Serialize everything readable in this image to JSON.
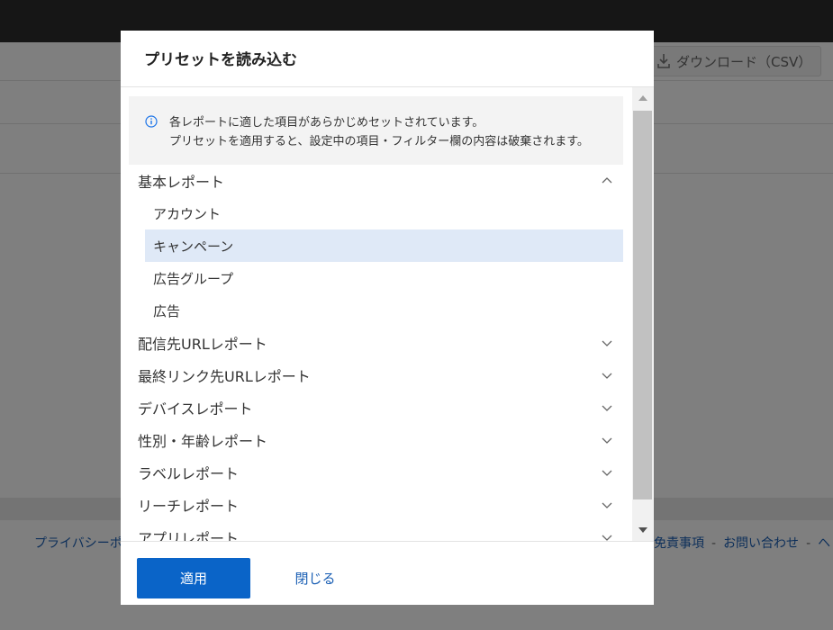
{
  "background": {
    "download_button": "ダウンロード（CSV）",
    "footer_left": "プライバシーポ",
    "footer_right": [
      "免責事項",
      "お問い合わせ",
      "ヘ"
    ],
    "footer_sep": "-"
  },
  "modal": {
    "title": "プリセットを読み込む",
    "info": {
      "line1": "各レポートに適した項目があらかじめセットされています。",
      "line2": "プリセットを適用すると、設定中の項目・フィルター欄の内容は破棄されます。"
    },
    "categories": [
      {
        "label": "基本レポート",
        "expanded": true,
        "items": [
          {
            "label": "アカウント",
            "selected": false
          },
          {
            "label": "キャンペーン",
            "selected": true
          },
          {
            "label": "広告グループ",
            "selected": false
          },
          {
            "label": "広告",
            "selected": false
          }
        ]
      },
      {
        "label": "配信先URLレポート",
        "expanded": false
      },
      {
        "label": "最終リンク先URLレポート",
        "expanded": false
      },
      {
        "label": "デバイスレポート",
        "expanded": false
      },
      {
        "label": "性別・年齢レポート",
        "expanded": false
      },
      {
        "label": "ラベルレポート",
        "expanded": false
      },
      {
        "label": "リーチレポート",
        "expanded": false
      },
      {
        "label": "アプリレポート",
        "expanded": false
      }
    ],
    "apply_label": "適用",
    "close_label": "閉じる"
  },
  "colors": {
    "primary": "#0a64c8",
    "selected_bg": "#dfe9f7",
    "link": "#1a5fb4",
    "info_icon": "#1a73e8"
  },
  "icons": {
    "info": "info-icon",
    "chevron_up": "chevron-up-icon",
    "chevron_down": "chevron-down-icon",
    "download": "download-icon"
  }
}
